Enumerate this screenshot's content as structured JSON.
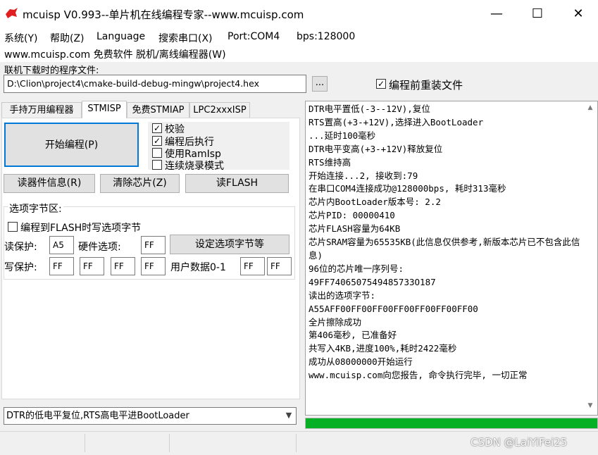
{
  "window": {
    "title": "mcuisp V0.993--单片机在线编程专家--www.mcuisp.com",
    "minimize": "—",
    "maximize": "☐",
    "close": "✕"
  },
  "menu": {
    "items": [
      "系统(Y)",
      "帮助(Z)",
      "Language",
      "搜索串口(X)",
      "Port:COM4",
      "bps:128000"
    ]
  },
  "subtitle": "www.mcuisp.com 免费软件 脱机/离线编程器(W)",
  "file": {
    "label": "联机下载时的程序文件:",
    "path": "D:\\Clion\\project4\\cmake-build-debug-mingw\\project4.hex",
    "browse": "...",
    "reload_checked": true,
    "reload_label": "编程前重装文件"
  },
  "tabs": [
    "手持万用编程器",
    "STMISP",
    "免费STMIAP",
    "LPC2xxxISP"
  ],
  "active_tab": "STMISP",
  "actions": {
    "start": "开始编程(P)",
    "read_info": "读器件信息(R)",
    "erase": "清除芯片(Z)",
    "read_flash": "读FLASH"
  },
  "options": [
    {
      "label": "校验",
      "checked": true
    },
    {
      "label": "编程后执行",
      "checked": true
    },
    {
      "label": "使用RamIsp",
      "checked": false
    },
    {
      "label": "连续烧录模式",
      "checked": false
    }
  ],
  "option_bytes": {
    "title": "选项字节区:",
    "write_to_flash_label": "编程到FLASH时写选项字节",
    "write_to_flash_checked": false,
    "read_protect_label": "读保护:",
    "read_protect_value": "A5",
    "hw_option_label": "硬件选项:",
    "hw_option_value": "FF",
    "set_button": "设定选项字节等",
    "write_protect_label": "写保护:",
    "write_protect_values": [
      "FF",
      "FF",
      "FF",
      "FF"
    ],
    "user_data_label": "用户数据0-1",
    "user_data_values": [
      "FF",
      "FF"
    ]
  },
  "reset_mode": "DTR的低电平复位,RTS高电平进BootLoader",
  "log": "DTR电平置低(-3--12V),复位\nRTS置高(+3-+12V),选择进入BootLoader\n...延时100毫秒\nDTR电平变高(+3-+12V)释放复位\nRTS维持高\n开始连接...2, 接收到:79\n在串口COM4连接成功@128000bps, 耗时313毫秒\n芯片内BootLoader版本号: 2.2\n芯片PID: 00000410\n芯片FLASH容量为64KB\n芯片SRAM容量为65535KB(此信息仅供参考,新版本芯片已不包含此信息)\n96位的芯片唯一序列号:\n49FF7406507549485733O187\n读出的选项字节:\nA55AFF00FF00FF00FF00FF00FF00FF00\n全片擦除成功\n第406毫秒, 已准备好\n共写入4KB,进度100%,耗时2422毫秒\n成功从08000000开始运行\nwww.mcuisp.com向您报告, 命令执行完毕, 一切正常",
  "progress": 1.0,
  "colors": {
    "progress": "#06b025",
    "logo": "#e02020",
    "focus": "#0078d7"
  },
  "watermark": "CSDN @LaiYiFei25"
}
